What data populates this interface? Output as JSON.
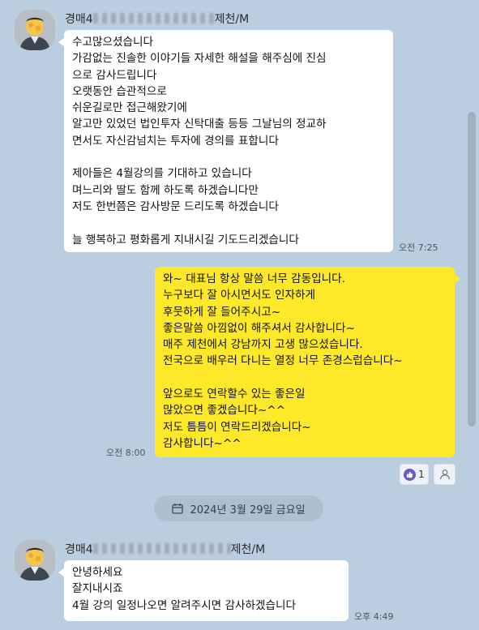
{
  "messages": {
    "msg1": {
      "sender_prefix": "경매4",
      "sender_suffix": "제천/M",
      "text": "수고많으셨습니다\n가감없는 진솔한 이야기들 자세한 해설을 해주심에 진심\n으로 감사드립니다\n오랫동안 습관적으로\n쉬운길로만 접근해왔기에\n알고만 있었던 법인투자 신탁대출 등등 그날님의 정교하\n면서도 자신감넘치는 투자에 경의를 표합니다\n\n제아들은 4월강의를 기대하고 있습니다\n며느리와 딸도 함께 하도록 하겠습니다만\n저도 한번쯤은 감사방문 드리도록 하겠습니다\n\n늘 행복하고 평화롭게 지내시길 기도드리겠습니다",
      "time": "오전 7:25"
    },
    "msg2": {
      "text": "와~ 대표님 항상 말씀 너무 감동입니다.\n누구보다 잘 아시면서도 인자하게\n후뭇하게 잘 들어주시고~\n좋은말씀 아낌없이 해주셔서 감사합니다~\n매주 제천에서 강남까지 고생 많으셨습니다.\n전국으로 배우러 다니는 열정 너무 존경스럽습니다~\n\n앞으로도 연락할수 있는 좋은일\n많았으면 좋겠습니다~^^\n저도 틈틈이 연락드리겠습니다~\n감사합니다~^^",
      "time": "오전 8:00",
      "reaction_count": "1"
    },
    "date_divider": "2024년 3월 29일 금요일",
    "msg3": {
      "sender_prefix": "경매4",
      "sender_suffix": "제천/M",
      "text": "안녕하세요\n잘지내시죠\n4월 강의 일정나오면 알려주시면 감사하겠습니다",
      "time": "오후 4:49"
    }
  },
  "icons": {
    "reaction": "thumbs-up-icon",
    "reactor": "person-icon",
    "date": "calendar-icon"
  },
  "colors": {
    "background": "#bacee0",
    "my_bubble": "#fee82a",
    "their_bubble": "#ffffff",
    "reaction_badge": "#6f56c7"
  }
}
